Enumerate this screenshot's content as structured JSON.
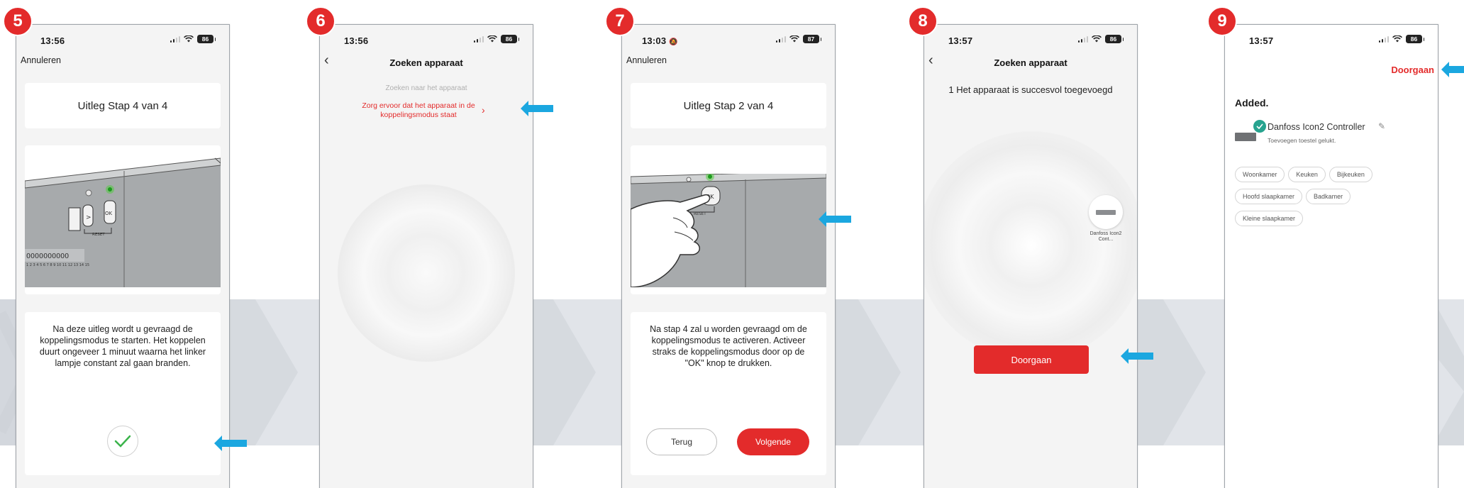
{
  "colors": {
    "accent_red": "#e32b2b",
    "arrow_blue": "#1ba7e0",
    "band_gray": "#e1e4e9"
  },
  "steps": [
    {
      "number": "5",
      "status": {
        "time": "13:56",
        "battery": "86"
      },
      "top_link": "Annuleren",
      "card_title": "Uitleg Stap 4 van 4",
      "reset_label": "RESET",
      "ok_label": "OK",
      "digits": "1 2 3 4 5 6 7 8 9 10 11 12 13 14 15",
      "description": "Na deze uitleg wordt u gevraagd de koppelingsmodus te starten. Het koppelen duurt ongeveer 1 minuut waarna het linker lampje constant zal gaan branden.",
      "confirm_icon": "checkmark-circle-icon"
    },
    {
      "number": "6",
      "status": {
        "time": "13:56",
        "battery": "86"
      },
      "nav_title": "Zoeken apparaat",
      "back_icon": "chevron-left-icon",
      "searching_text": "Zoeken naar het apparaat",
      "hint_text": "Zorg ervoor dat het apparaat in de koppelingsmodus staat",
      "hint_chevron": "›"
    },
    {
      "number": "7",
      "status": {
        "time": "13:03",
        "battery": "87",
        "extra_icon": "do-not-disturb-bell-icon"
      },
      "top_link": "Annuleren",
      "card_title": "Uitleg Stap 2 van 4",
      "reset_label": "RESET",
      "ok_label": "OK",
      "description": "Na stap 4 zal u worden gevraagd om de koppelingsmodus te activeren. Activeer straks de koppelingsmodus door op de \"OK\" knop te drukken.",
      "back_button": "Terug",
      "next_button": "Volgende"
    },
    {
      "number": "8",
      "status": {
        "time": "13:57",
        "battery": "86"
      },
      "nav_title": "Zoeken apparaat",
      "back_icon": "chevron-left-icon",
      "success_text": "1 Het apparaat is succesvol toegevoegd",
      "device_label": "Danfoss Icon2 Cont...",
      "continue_button": "Doorgaan"
    },
    {
      "number": "9",
      "status": {
        "time": "13:57",
        "battery": "86"
      },
      "continue_link": "Doorgaan",
      "added_heading": "Added.",
      "device_name": "Danfoss Icon2 Controller",
      "device_status": "Toevoegen toestel gelukt.",
      "rooms": [
        "Woonkamer",
        "Keuken",
        "Bijkeuken",
        "Hoofd slaapkamer",
        "Badkamer",
        "Kleine slaapkamer"
      ]
    }
  ]
}
